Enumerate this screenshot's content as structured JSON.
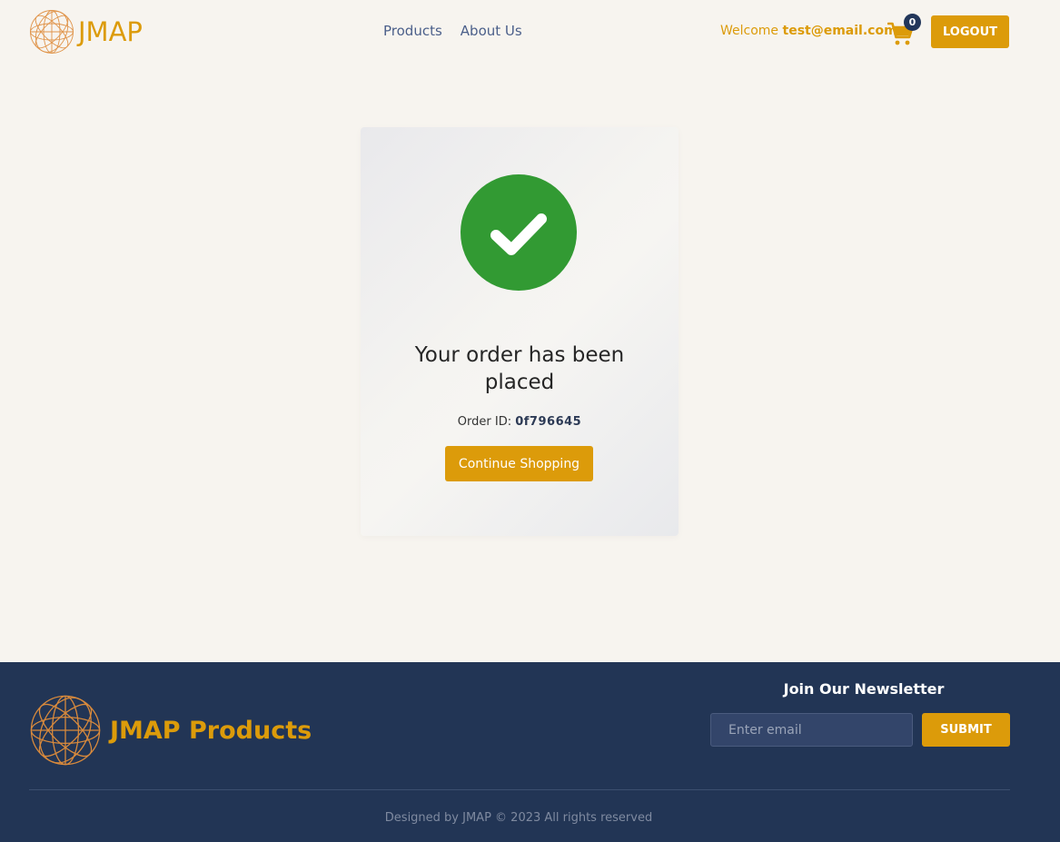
{
  "header": {
    "brand": "JMAP",
    "nav": [
      {
        "label": "Products"
      },
      {
        "label": "About Us"
      }
    ],
    "welcome_prefix": "Welcome",
    "user_email": "test@email.com",
    "cart_count": "0",
    "logout_label": "LOGOUT"
  },
  "confirmation": {
    "title": "Your order has been placed",
    "order_id_label": "Order ID:",
    "order_id": "0f796645",
    "continue_label": "Continue Shopping"
  },
  "footer": {
    "brand": "JMAP Products",
    "newsletter_title": "Join Our Newsletter",
    "email_placeholder": "Enter email",
    "submit_label": "SUBMIT",
    "copyright": "Designed by JMAP © 2023 All rights reserved"
  },
  "colors": {
    "accent": "#dc9b0a",
    "navy": "#223555",
    "success": "#329a33",
    "background": "#f7f4ef"
  },
  "icons": [
    "globe-logo-icon",
    "cart-icon",
    "check-circle-icon"
  ]
}
